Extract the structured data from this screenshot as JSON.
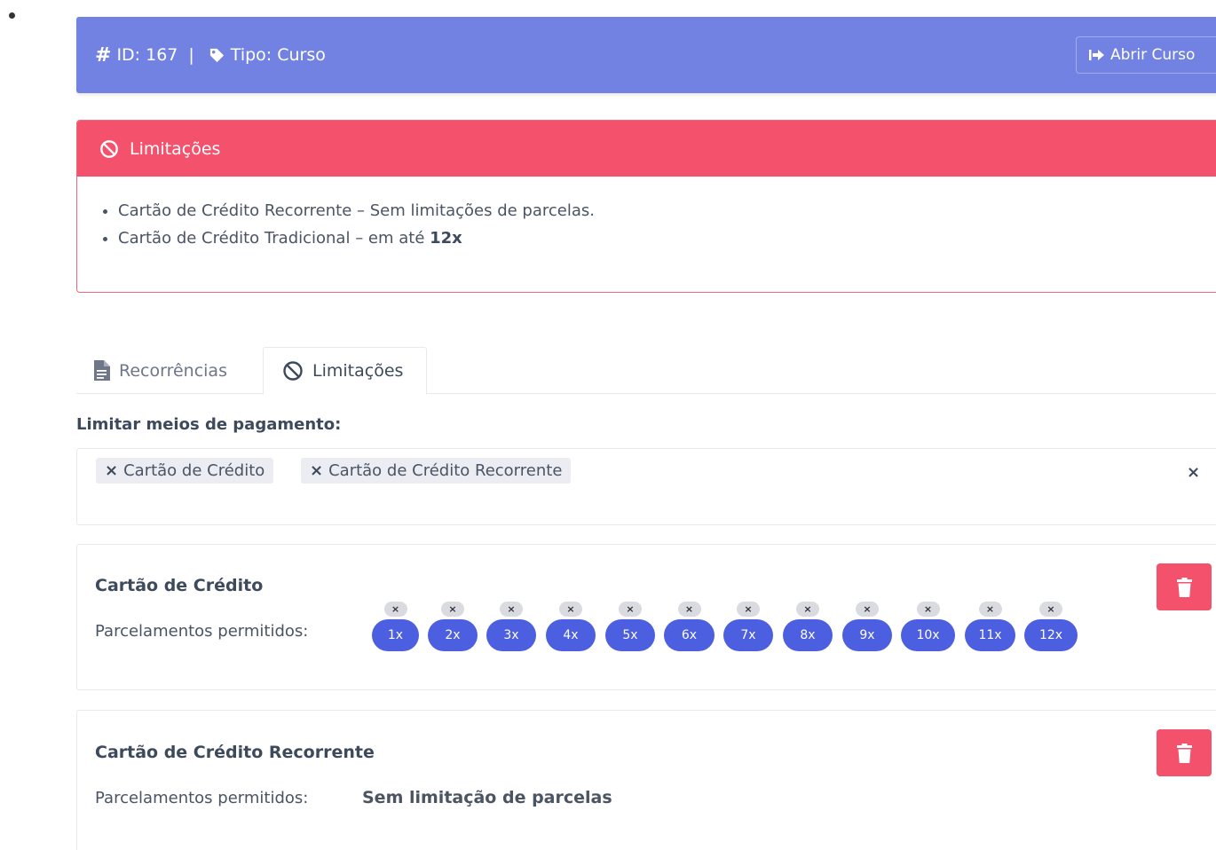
{
  "header": {
    "id_text": "ID: 167",
    "separator": "|",
    "type_text": "Tipo: Curso",
    "open_button_label": "Abrir Curso",
    "color": "#7282e2"
  },
  "limits_panel": {
    "title": "Limitações",
    "color": "#f4516c",
    "items": [
      {
        "text": "Cartão de Crédito Recorrente – Sem limitações de parcelas.",
        "bold": ""
      },
      {
        "text": "Cartão de Crédito Tradicional – em até ",
        "bold": "12x"
      }
    ]
  },
  "tabs": [
    {
      "label": "Recorrências",
      "icon": "file-icon",
      "active": false
    },
    {
      "label": "Limitações",
      "icon": "ban-icon",
      "active": true
    }
  ],
  "payment_limits": {
    "label": "Limitar meios de pagamento:",
    "selected": [
      "Cartão de Crédito",
      "Cartão de Crédito Recorrente"
    ],
    "remove_glyph": "×",
    "clear_glyph": "×"
  },
  "cards": [
    {
      "title": "Cartão de Crédito",
      "label": "Parcelamentos permitidos:",
      "installments": [
        "1x",
        "2x",
        "3x",
        "4x",
        "5x",
        "6x",
        "7x",
        "8x",
        "9x",
        "10x",
        "11x",
        "12x"
      ]
    },
    {
      "title": "Cartão de Crédito Recorrente",
      "label": "Parcelamentos permitidos:",
      "value": "Sem limitação de parcelas"
    }
  ],
  "pill_color": "#4c5fe0",
  "delete_color": "#f4516c"
}
